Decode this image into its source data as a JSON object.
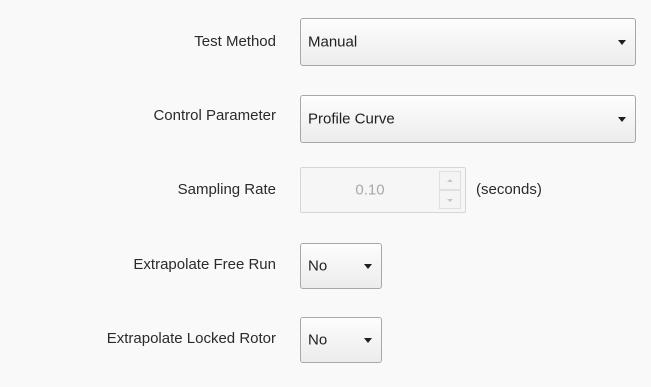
{
  "test_method": {
    "label": "Test Method",
    "value": "Manual"
  },
  "control_parameter": {
    "label": "Control Parameter",
    "value": "Profile Curve"
  },
  "sampling_rate": {
    "label": "Sampling Rate",
    "value": "0.10",
    "units": "(seconds)",
    "enabled": false
  },
  "extrapolate_free_run": {
    "label": "Extrapolate Free Run",
    "value": "No"
  },
  "extrapolate_locked_rotor": {
    "label": "Extrapolate Locked Rotor",
    "value": "No"
  },
  "icons": {
    "dropdown": "chevron-down-icon",
    "spin_up": "spin-up-icon",
    "spin_down": "spin-down-icon"
  },
  "colors": {
    "background": "#f9f9f9",
    "text": "#2b2b2b",
    "disabled_text": "#a9a9a9",
    "border": "#a8a8a8"
  }
}
